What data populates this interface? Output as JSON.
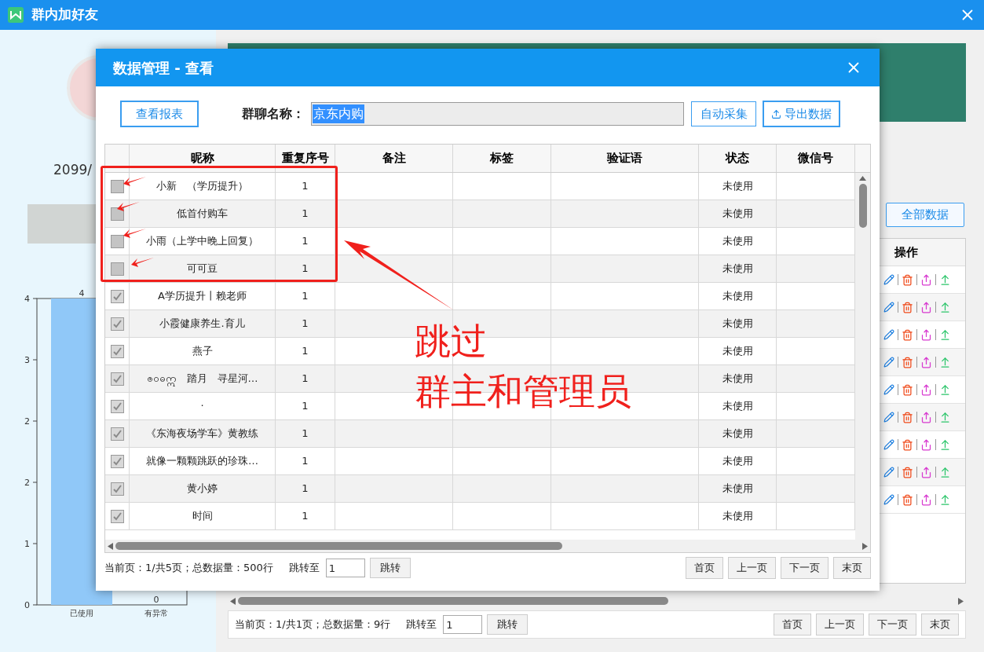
{
  "window": {
    "title": "群内加好友"
  },
  "left_panel": {
    "date_text": "2099/",
    "chart_data": {
      "type": "bar",
      "categories": [
        "已使用",
        "有异常"
      ],
      "values": [
        4,
        0
      ],
      "ylim": [
        0,
        4
      ],
      "yticks": [
        {
          "value": 0,
          "label": "0"
        },
        {
          "value": 0.8,
          "label": "1"
        },
        {
          "value": 1.6,
          "label": "2"
        },
        {
          "value": 2.4,
          "label": "2"
        },
        {
          "value": 3.2,
          "label": "3"
        },
        {
          "value": 4,
          "label": "4"
        }
      ],
      "data_labels": true
    }
  },
  "main": {
    "all_data_button": "全部数据",
    "table": {
      "columns": [
        "操作"
      ],
      "rows": [
        {
          "kind": "actions"
        },
        {
          "kind": "actions"
        },
        {
          "kind": "actions"
        },
        {
          "kind": "actions"
        },
        {
          "kind": "actions"
        },
        {
          "kind": "actions"
        },
        {
          "kind": "actions"
        },
        {
          "kind": "actions"
        },
        {
          "kind": "actions"
        }
      ]
    },
    "pagination": {
      "info": "当前页：1/共1页；总数据量：9行",
      "jump_label": "跳转至",
      "jump_value": "1",
      "jump_button": "跳转",
      "buttons": [
        "首页",
        "上一页",
        "下一页",
        "末页"
      ]
    }
  },
  "dialog": {
    "title": "数据管理 - 查看",
    "report_button": "查看报表",
    "group_label": "群聊名称：",
    "group_value": "京东内购",
    "group_value_selected": true,
    "collect_button": "自动采集",
    "export_button": "导出数据",
    "columns": [
      "",
      "昵称",
      "重复序号",
      "备注",
      "标签",
      "验证语",
      "状态",
      "微信号"
    ],
    "rows": [
      {
        "checked": false,
        "nickname": "小新　（学历提升）",
        "dup_no": "1",
        "status": "未使用"
      },
      {
        "checked": false,
        "nickname": "低首付购车",
        "dup_no": "1",
        "status": "未使用"
      },
      {
        "checked": false,
        "nickname": "小雨（上学中晚上回复）",
        "dup_no": "1",
        "status": "未使用"
      },
      {
        "checked": false,
        "nickname": "可可豆",
        "dup_no": "1",
        "status": "未使用"
      },
      {
        "checked": true,
        "nickname": "A学历提升丨赖老师",
        "dup_no": "1",
        "status": "未使用"
      },
      {
        "checked": true,
        "nickname": "小霞健康养生.育儿",
        "dup_no": "1",
        "status": "未使用"
      },
      {
        "checked": true,
        "nickname": "燕子",
        "dup_no": "1",
        "status": "未使用"
      },
      {
        "checked": true,
        "nickname": "ၜ၀ဓဣ　踏月　寻星河…",
        "dup_no": "1",
        "status": "未使用"
      },
      {
        "checked": true,
        "nickname": "·",
        "dup_no": "1",
        "status": "未使用"
      },
      {
        "checked": true,
        "nickname": "《东海夜场学车》黄教练",
        "dup_no": "1",
        "status": "未使用"
      },
      {
        "checked": true,
        "nickname": "就像一颗颗跳跃的珍珠…",
        "dup_no": "1",
        "status": "未使用"
      },
      {
        "checked": true,
        "nickname": "黄小婷",
        "dup_no": "1",
        "status": "未使用"
      },
      {
        "checked": true,
        "nickname": "时间",
        "dup_no": "1",
        "status": "未使用"
      }
    ],
    "pagination": {
      "info": "当前页：1/共5页；总数据量：500行",
      "jump_label": "跳转至",
      "jump_value": "1",
      "jump_button": "跳转",
      "buttons": [
        "首页",
        "上一页",
        "下一页",
        "末页"
      ]
    }
  },
  "annotation": {
    "lines": [
      "跳过",
      "群主和管理员"
    ]
  }
}
